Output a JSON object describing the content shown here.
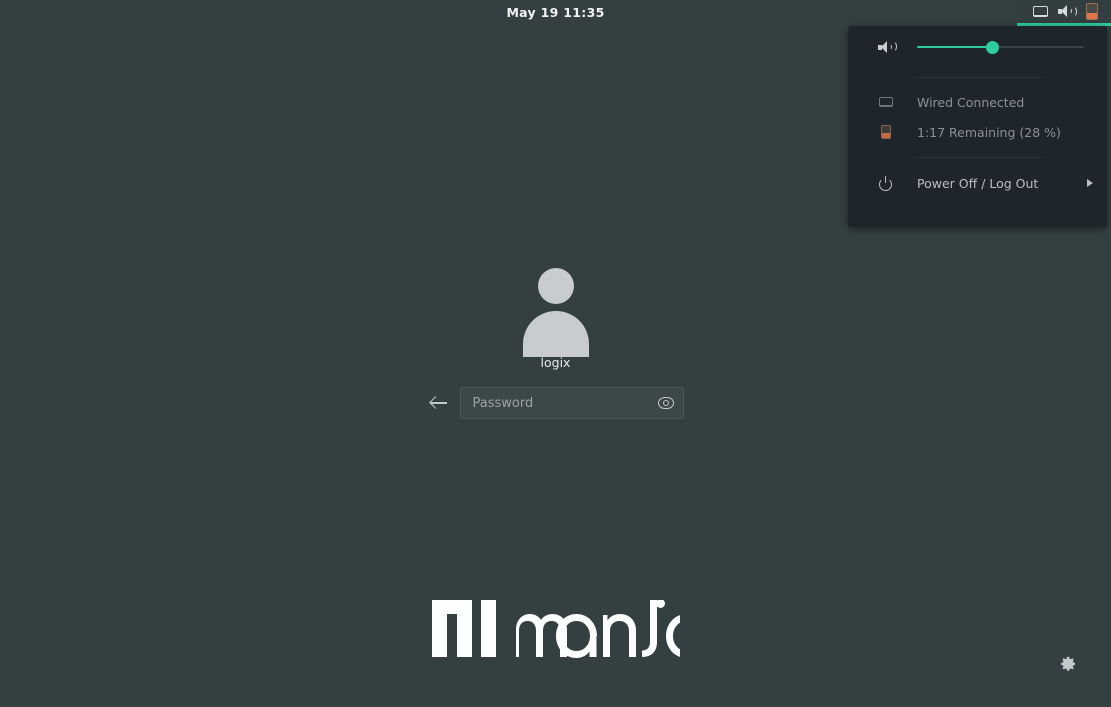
{
  "screen": {
    "background_color": "#343f41",
    "accent_color": "#2ecc9e"
  },
  "top_panel": {
    "clock": "May 19  11:35",
    "tray": [
      {
        "name": "network-monitor-icon",
        "label": "Wired"
      },
      {
        "name": "volume-icon",
        "label": "Volume"
      },
      {
        "name": "battery-icon",
        "label": "Battery"
      }
    ]
  },
  "system_menu": {
    "volume": {
      "icon": "speaker-icon",
      "value": 45,
      "min": 0,
      "max": 100
    },
    "rows": [
      {
        "icon": "network-monitor-icon",
        "label": "Wired Connected"
      },
      {
        "icon": "battery-icon",
        "label": "1:17 Remaining (28 %)"
      }
    ],
    "power": {
      "icon": "power-icon",
      "label": "Power Off / Log Out",
      "submenu_arrow": "▶"
    }
  },
  "login": {
    "avatar": "default-user-avatar",
    "username": "logix",
    "password_placeholder": "Password",
    "password_value": "",
    "back_button": "back-arrow-icon",
    "reveal_button": "eye-icon"
  },
  "brand": {
    "name": "manjaro",
    "logo_color": "#fcfdfd"
  },
  "settings": {
    "icon": "gear-icon",
    "label": "Settings"
  }
}
